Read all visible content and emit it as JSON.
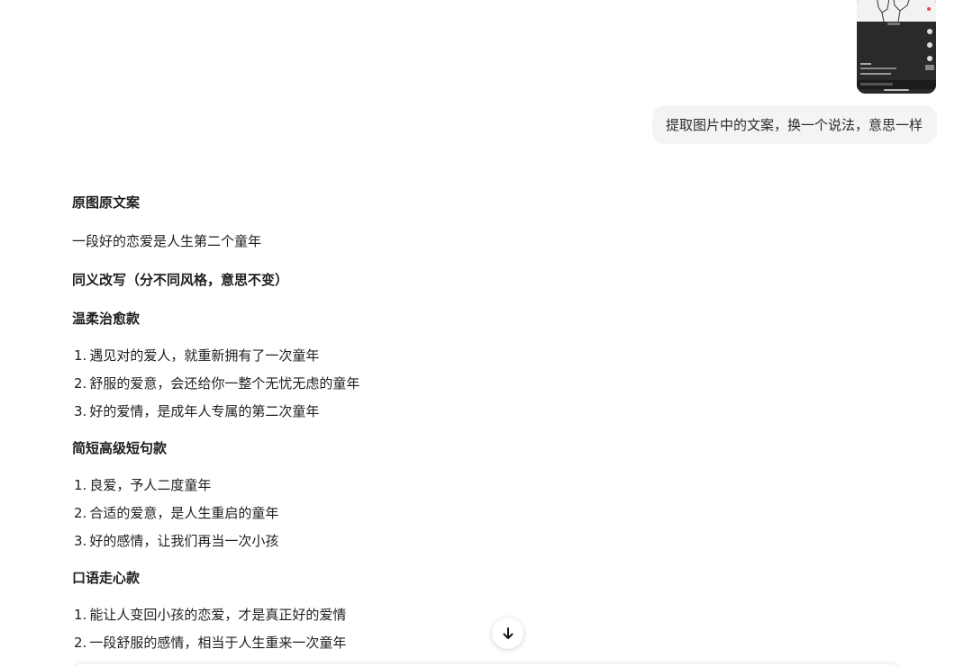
{
  "attachment": {
    "icon": "phone-screenshot-thumbnail"
  },
  "user_message": {
    "text": "提取图片中的文案，换一个说法，意思一样"
  },
  "answer": {
    "original_heading": "原图原文案",
    "original_text": "一段好的恋爱是人生第二个童年",
    "rewrite_heading": "同义改写（分不同风格，意思不变）",
    "sections": [
      {
        "title": "温柔治愈款",
        "items": [
          {
            "num": "1.",
            "text": "遇见对的爱人，就重新拥有了一次童年"
          },
          {
            "num": "2.",
            "text": "舒服的爱意，会还给你一整个无忧无虑的童年"
          },
          {
            "num": "3.",
            "text": "好的爱情，是成年人专属的第二次童年"
          }
        ]
      },
      {
        "title": "简短高级短句款",
        "items": [
          {
            "num": "1.",
            "text": "良爱，予人二度童年"
          },
          {
            "num": "2.",
            "text": "合适的爱意，是人生重启的童年"
          },
          {
            "num": "3.",
            "text": "好的感情，让我们再当一次小孩"
          }
        ]
      },
      {
        "title": "口语走心款",
        "items": [
          {
            "num": "1.",
            "text": "能让人变回小孩的恋爱，才是真正好的爱情"
          },
          {
            "num": "2.",
            "text": "一段舒服的感情，相当于人生重来一次童年"
          }
        ]
      }
    ]
  },
  "scroll_button": {
    "icon": "arrow-down-icon"
  }
}
